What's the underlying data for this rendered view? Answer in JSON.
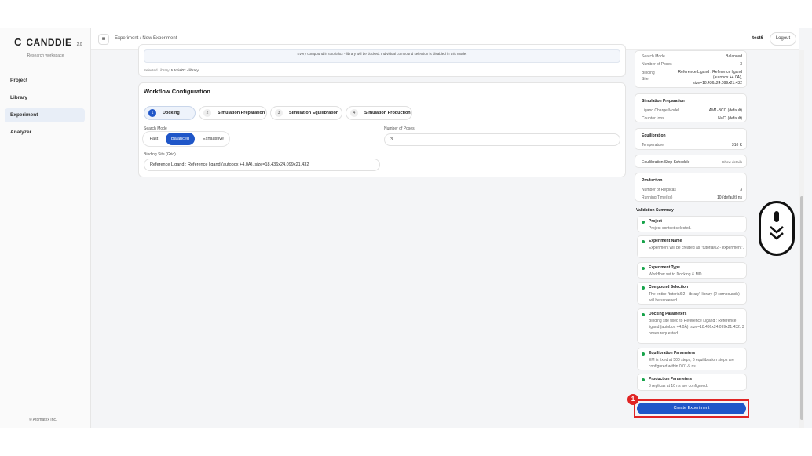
{
  "sidebar": {
    "logo_mark": "C",
    "brand": "CANDDIE",
    "version": "2.0",
    "workspace": "Research workspace",
    "items": [
      {
        "label": "Project"
      },
      {
        "label": "Library"
      },
      {
        "label": "Experiment"
      },
      {
        "label": "Analyzer"
      }
    ],
    "copyright": "© Atomatrix Inc."
  },
  "header": {
    "menu_icon": "≡",
    "breadcrumb": "Experiment / New Experiment",
    "user": "test6",
    "logout": "Logout"
  },
  "library_notice": "Every compound in tutorial02 - library will be docked. Individual compound selection is disabled in this mode.",
  "selected_library_label": "Selected Library",
  "selected_library_value": "tutorial02 - library",
  "workflow": {
    "title": "Workflow Configuration",
    "tabs": [
      {
        "num": "1",
        "label": "Docking"
      },
      {
        "num": "2",
        "label": "Simulation Preparation"
      },
      {
        "num": "3",
        "label": "Simulation Equilibration"
      },
      {
        "num": "4",
        "label": "Simulation Production"
      }
    ],
    "search_mode_label": "Search Mode",
    "search_modes": [
      "Fast",
      "Balanced",
      "Exhaustive"
    ],
    "num_poses_label": "Number of Poses",
    "num_poses_value": "3",
    "binding_site_label": "Binding Site (Grid)",
    "binding_site_value": "Reference Ligand : Reference ligand (autobox +4.0Å), size=18.436x24.099x21.432"
  },
  "summary": {
    "docking": {
      "search_mode_label": "Search Mode",
      "search_mode_value": "Balanced",
      "poses_label": "Number of Poses",
      "poses_value": "3",
      "binding_label": "Binding Site",
      "binding_value_1": "Reference Ligand : Reference ligand",
      "binding_value_2": "(autobox +4.0Å),",
      "binding_value_3": "size=18.436x24.099x21.432"
    },
    "prep": {
      "title": "Simulation Preparation",
      "charge_label": "Ligand Charge Model",
      "charge_value": "AM1-BCC (default)",
      "ions_label": "Counter Ions",
      "ions_value": "NaCl (default)"
    },
    "equil": {
      "title": "Equilibration",
      "temp_label": "Temperature",
      "temp_value": "310 K"
    },
    "schedule": {
      "label": "Equilibration Step Schedule",
      "action": "Show details"
    },
    "production": {
      "title": "Production",
      "replicas_label": "Number of Replicas",
      "replicas_value": "3",
      "runtime_label": "Running Time(ns)",
      "runtime_value": "10 (default) ns"
    }
  },
  "validation": {
    "title": "Validation Summary",
    "items": [
      {
        "title": "Project",
        "desc": "Project context selected."
      },
      {
        "title": "Experiment Name",
        "desc": "Experiment will be created as \"tutorial02 - experiment\"."
      },
      {
        "title": "Experiment Type",
        "desc": "Workflow set to Docking & MD."
      },
      {
        "title": "Compound Selection",
        "desc": "The entire \"tutorial02 - library\" library (2 compounds) will be screened."
      },
      {
        "title": "Docking Parameters",
        "desc": "Binding site fixed to Reference Ligand : Reference ligand (autobox +4.0Å), size=18.436x24.099x21.432. 3 poses requested."
      },
      {
        "title": "Equilibration Parameters",
        "desc": "EM is fixed at 500 steps; 6 equilibration steps are configured within 0.01-5 ns."
      },
      {
        "title": "Production Parameters",
        "desc": "3 replicas at 10 ns are configured."
      }
    ]
  },
  "create_button": "Create Experiment",
  "annotation_badge": "1",
  "colors": {
    "accent": "#1f56c8",
    "highlight": "#e02424",
    "ok": "#16a34a"
  }
}
